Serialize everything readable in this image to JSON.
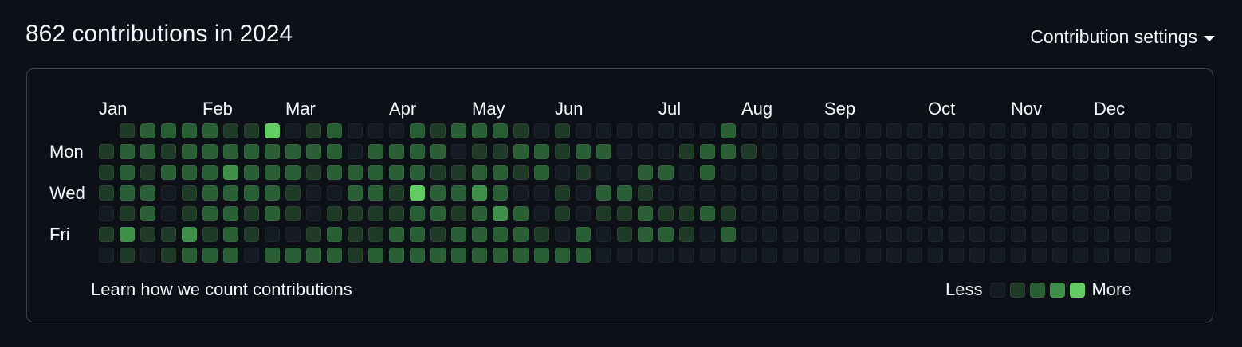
{
  "header": {
    "title": "862 contributions in 2024",
    "settings_label": "Contribution settings"
  },
  "months": [
    "Jan",
    "Feb",
    "Mar",
    "Apr",
    "May",
    "Jun",
    "Jul",
    "Aug",
    "Sep",
    "Oct",
    "Nov",
    "Dec"
  ],
  "day_labels": [
    "Mon",
    "Wed",
    "Fri"
  ],
  "footer": {
    "learn_link": "Learn how we count contributions",
    "legend_less": "Less",
    "legend_more": "More"
  },
  "colors": {
    "level0": "#151b23",
    "level1": "#1f3b27",
    "level2": "#2a5f35",
    "level3": "#3f8f4a",
    "level4": "#63cb63",
    "background": "#0d1117",
    "border": "#3d444d"
  },
  "contribution_levels": [
    "0122221140120002122210100000002000000000000000000000000",
    "1221222222220222201122122000122100000000000000000000000",
    "1212223222122222112212010022020000000000000000000000000",
    "1220122221002214223200102210000000000000000000000000000",
    "0120122121011112212320101121121000000000000000000000000",
    "1311312100121122122221020122102000000000000000000000000",
    "0101222022221222222222220000000000000000000000000000000"
  ]
}
